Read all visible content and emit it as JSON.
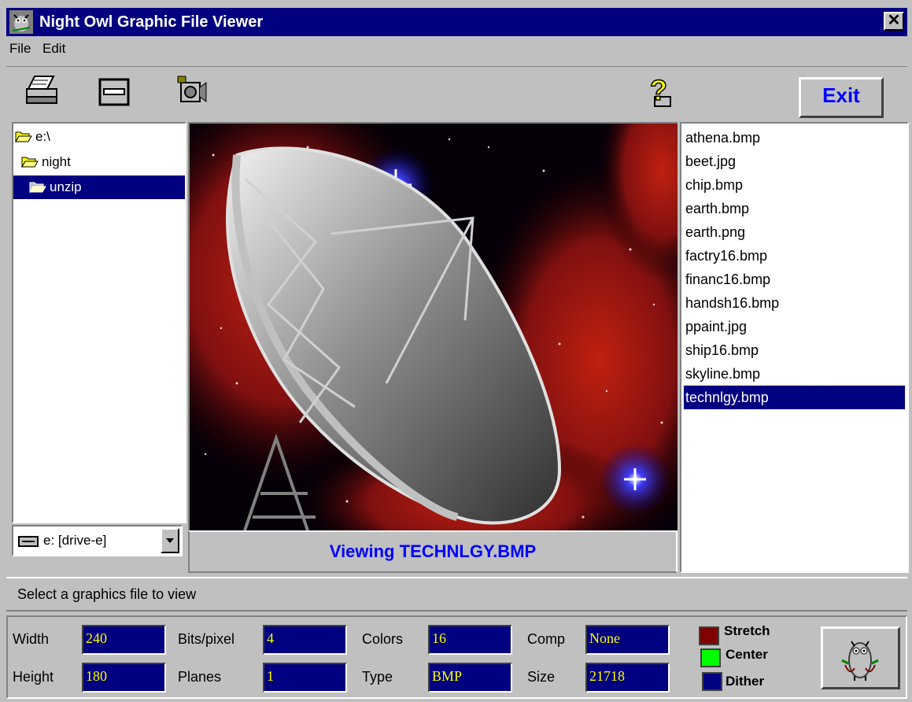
{
  "window": {
    "title": "Night Owl Graphic File Viewer",
    "close_glyph": "✕"
  },
  "menu": {
    "file": "File",
    "edit": "Edit"
  },
  "toolbar": {
    "print_icon": "printer-icon",
    "scanner_icon": "scanner-icon",
    "camera_icon": "camera-icon",
    "help_icon": "help-icon",
    "exit_label": "Exit"
  },
  "tree": {
    "items": [
      {
        "label": "e:\\",
        "state": "open"
      },
      {
        "label": "night",
        "state": "open"
      },
      {
        "label": "unzip",
        "state": "selected"
      }
    ]
  },
  "drive": {
    "label": "e: [drive-e]"
  },
  "viewer": {
    "caption": "Viewing TECHNLGY.BMP"
  },
  "files": {
    "items": [
      "athena.bmp",
      "beet.jpg",
      "chip.bmp",
      "earth.bmp",
      "earth.png",
      "factry16.bmp",
      "financ16.bmp",
      "handsh16.bmp",
      "ppaint.jpg",
      "ship16.bmp",
      "skyline.bmp",
      "technlgy.bmp"
    ],
    "selected": "technlgy.bmp"
  },
  "status": {
    "text": "Select a graphics file to view"
  },
  "info": {
    "width_label": "Width",
    "width_value": "240",
    "height_label": "Height",
    "height_value": "180",
    "bits_label": "Bits/pixel",
    "bits_value": "4",
    "planes_label": "Planes",
    "planes_value": "1",
    "colors_label": "Colors",
    "colors_value": "16",
    "type_label": "Type",
    "type_value": "BMP",
    "comp_label": "Comp",
    "comp_value": "None",
    "size_label": "Size",
    "size_value": "21718"
  },
  "options": {
    "stretch": {
      "label": "Stretch",
      "color": "#800000"
    },
    "center": {
      "label": "Center",
      "color": "#00ff00"
    },
    "dither": {
      "label": "Dither",
      "color": "#000080"
    }
  },
  "colors": {
    "title_bar": "#000080",
    "chrome": "#c0c0c0",
    "value_text": "#ffff00",
    "accent": "#0000ff"
  }
}
